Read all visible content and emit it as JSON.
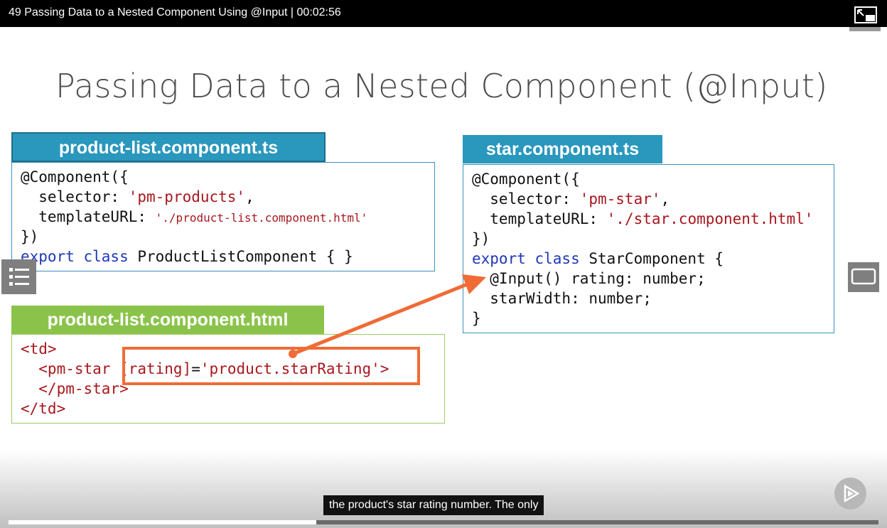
{
  "player": {
    "title": "49 Passing Data to a Nested Component Using @Input | 00:02:56",
    "caption": "the product's star rating number. The only",
    "progress_fraction": 0.354
  },
  "slide": {
    "title": "Passing Data to a Nested Component (@Input)",
    "panel1": {
      "header": "product-list.component.ts",
      "lines": {
        "l1": "@Component({",
        "l2_key": "  selector: ",
        "l2_val": "'pm-products'",
        "l2_end": ",",
        "l3_key": "  templateURL: ",
        "l3_val": "'./product-list.component.html'",
        "l4": "})",
        "l5_kw": "export class",
        "l5_rest": " ProductListComponent { }"
      }
    },
    "panel2": {
      "header": "product-list.component.html",
      "lines": {
        "l1": "<td>",
        "l2_pre": "  <pm-star ",
        "l2_attr": "[rating]",
        "l2_eq": "=",
        "l2_val": "'product.starRating'",
        "l2_end": ">",
        "l3": "  </pm-star>",
        "l4": "</td>"
      }
    },
    "panel3": {
      "header": "star.component.ts",
      "lines": {
        "l1": "@Component({",
        "l2_key": "  selector: ",
        "l2_val": "'pm-star'",
        "l2_end": ",",
        "l3_key": "  templateURL: ",
        "l3_val": "'./star.component.html'",
        "l4": "})",
        "l5_kw": "export class",
        "l5_rest": " StarComponent {",
        "l6": "  @Input() rating: number;",
        "l7": "  starWidth: number;",
        "l8": "}"
      }
    }
  },
  "icons": {
    "pip": "exit-picture-in-picture-icon",
    "list": "list-icon",
    "screen": "screen-icon",
    "play": "play-logo-icon"
  },
  "colors": {
    "header_blue": "#2a97bd",
    "header_green": "#8bc34a",
    "highlight": "#f06b36",
    "keyword": "#1f37b6",
    "string": "#a8171e"
  }
}
